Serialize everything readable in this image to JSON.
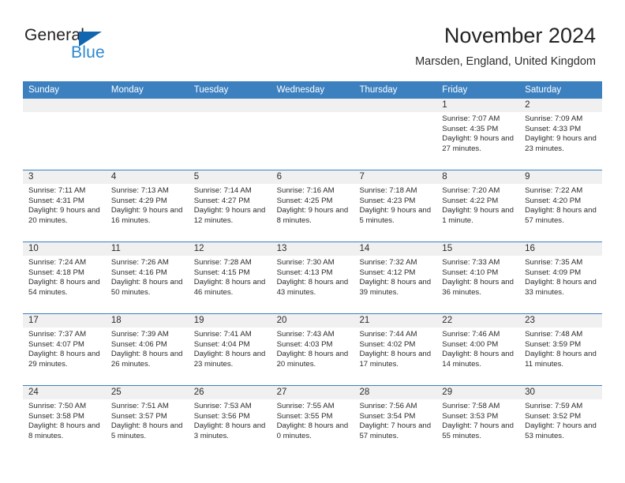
{
  "logo": {
    "word_top": "General",
    "word_bottom": "Blue",
    "triangle_color": "#1266b0",
    "blue_text_color": "#2f87cf"
  },
  "header": {
    "title": "November 2024",
    "subtitle": "Marsden, England, United Kingdom"
  },
  "theme": {
    "header_row_bg": "#3c80c0",
    "daynum_bg": "#f0f0f0",
    "text_color": "#2b2b2b"
  },
  "weekdays": [
    "Sunday",
    "Monday",
    "Tuesday",
    "Wednesday",
    "Thursday",
    "Friday",
    "Saturday"
  ],
  "weeks": [
    [
      {
        "day": "",
        "sunrise": "",
        "sunset": "",
        "daylight": "",
        "empty": true
      },
      {
        "day": "",
        "sunrise": "",
        "sunset": "",
        "daylight": "",
        "empty": true
      },
      {
        "day": "",
        "sunrise": "",
        "sunset": "",
        "daylight": "",
        "empty": true
      },
      {
        "day": "",
        "sunrise": "",
        "sunset": "",
        "daylight": "",
        "empty": true
      },
      {
        "day": "",
        "sunrise": "",
        "sunset": "",
        "daylight": "",
        "empty": true
      },
      {
        "day": "1",
        "sunrise": "Sunrise: 7:07 AM",
        "sunset": "Sunset: 4:35 PM",
        "daylight": "Daylight: 9 hours and 27 minutes."
      },
      {
        "day": "2",
        "sunrise": "Sunrise: 7:09 AM",
        "sunset": "Sunset: 4:33 PM",
        "daylight": "Daylight: 9 hours and 23 minutes."
      }
    ],
    [
      {
        "day": "3",
        "sunrise": "Sunrise: 7:11 AM",
        "sunset": "Sunset: 4:31 PM",
        "daylight": "Daylight: 9 hours and 20 minutes."
      },
      {
        "day": "4",
        "sunrise": "Sunrise: 7:13 AM",
        "sunset": "Sunset: 4:29 PM",
        "daylight": "Daylight: 9 hours and 16 minutes."
      },
      {
        "day": "5",
        "sunrise": "Sunrise: 7:14 AM",
        "sunset": "Sunset: 4:27 PM",
        "daylight": "Daylight: 9 hours and 12 minutes."
      },
      {
        "day": "6",
        "sunrise": "Sunrise: 7:16 AM",
        "sunset": "Sunset: 4:25 PM",
        "daylight": "Daylight: 9 hours and 8 minutes."
      },
      {
        "day": "7",
        "sunrise": "Sunrise: 7:18 AM",
        "sunset": "Sunset: 4:23 PM",
        "daylight": "Daylight: 9 hours and 5 minutes."
      },
      {
        "day": "8",
        "sunrise": "Sunrise: 7:20 AM",
        "sunset": "Sunset: 4:22 PM",
        "daylight": "Daylight: 9 hours and 1 minute."
      },
      {
        "day": "9",
        "sunrise": "Sunrise: 7:22 AM",
        "sunset": "Sunset: 4:20 PM",
        "daylight": "Daylight: 8 hours and 57 minutes."
      }
    ],
    [
      {
        "day": "10",
        "sunrise": "Sunrise: 7:24 AM",
        "sunset": "Sunset: 4:18 PM",
        "daylight": "Daylight: 8 hours and 54 minutes."
      },
      {
        "day": "11",
        "sunrise": "Sunrise: 7:26 AM",
        "sunset": "Sunset: 4:16 PM",
        "daylight": "Daylight: 8 hours and 50 minutes."
      },
      {
        "day": "12",
        "sunrise": "Sunrise: 7:28 AM",
        "sunset": "Sunset: 4:15 PM",
        "daylight": "Daylight: 8 hours and 46 minutes."
      },
      {
        "day": "13",
        "sunrise": "Sunrise: 7:30 AM",
        "sunset": "Sunset: 4:13 PM",
        "daylight": "Daylight: 8 hours and 43 minutes."
      },
      {
        "day": "14",
        "sunrise": "Sunrise: 7:32 AM",
        "sunset": "Sunset: 4:12 PM",
        "daylight": "Daylight: 8 hours and 39 minutes."
      },
      {
        "day": "15",
        "sunrise": "Sunrise: 7:33 AM",
        "sunset": "Sunset: 4:10 PM",
        "daylight": "Daylight: 8 hours and 36 minutes."
      },
      {
        "day": "16",
        "sunrise": "Sunrise: 7:35 AM",
        "sunset": "Sunset: 4:09 PM",
        "daylight": "Daylight: 8 hours and 33 minutes."
      }
    ],
    [
      {
        "day": "17",
        "sunrise": "Sunrise: 7:37 AM",
        "sunset": "Sunset: 4:07 PM",
        "daylight": "Daylight: 8 hours and 29 minutes."
      },
      {
        "day": "18",
        "sunrise": "Sunrise: 7:39 AM",
        "sunset": "Sunset: 4:06 PM",
        "daylight": "Daylight: 8 hours and 26 minutes."
      },
      {
        "day": "19",
        "sunrise": "Sunrise: 7:41 AM",
        "sunset": "Sunset: 4:04 PM",
        "daylight": "Daylight: 8 hours and 23 minutes."
      },
      {
        "day": "20",
        "sunrise": "Sunrise: 7:43 AM",
        "sunset": "Sunset: 4:03 PM",
        "daylight": "Daylight: 8 hours and 20 minutes."
      },
      {
        "day": "21",
        "sunrise": "Sunrise: 7:44 AM",
        "sunset": "Sunset: 4:02 PM",
        "daylight": "Daylight: 8 hours and 17 minutes."
      },
      {
        "day": "22",
        "sunrise": "Sunrise: 7:46 AM",
        "sunset": "Sunset: 4:00 PM",
        "daylight": "Daylight: 8 hours and 14 minutes."
      },
      {
        "day": "23",
        "sunrise": "Sunrise: 7:48 AM",
        "sunset": "Sunset: 3:59 PM",
        "daylight": "Daylight: 8 hours and 11 minutes."
      }
    ],
    [
      {
        "day": "24",
        "sunrise": "Sunrise: 7:50 AM",
        "sunset": "Sunset: 3:58 PM",
        "daylight": "Daylight: 8 hours and 8 minutes."
      },
      {
        "day": "25",
        "sunrise": "Sunrise: 7:51 AM",
        "sunset": "Sunset: 3:57 PM",
        "daylight": "Daylight: 8 hours and 5 minutes."
      },
      {
        "day": "26",
        "sunrise": "Sunrise: 7:53 AM",
        "sunset": "Sunset: 3:56 PM",
        "daylight": "Daylight: 8 hours and 3 minutes."
      },
      {
        "day": "27",
        "sunrise": "Sunrise: 7:55 AM",
        "sunset": "Sunset: 3:55 PM",
        "daylight": "Daylight: 8 hours and 0 minutes."
      },
      {
        "day": "28",
        "sunrise": "Sunrise: 7:56 AM",
        "sunset": "Sunset: 3:54 PM",
        "daylight": "Daylight: 7 hours and 57 minutes."
      },
      {
        "day": "29",
        "sunrise": "Sunrise: 7:58 AM",
        "sunset": "Sunset: 3:53 PM",
        "daylight": "Daylight: 7 hours and 55 minutes."
      },
      {
        "day": "30",
        "sunrise": "Sunrise: 7:59 AM",
        "sunset": "Sunset: 3:52 PM",
        "daylight": "Daylight: 7 hours and 53 minutes."
      }
    ]
  ]
}
